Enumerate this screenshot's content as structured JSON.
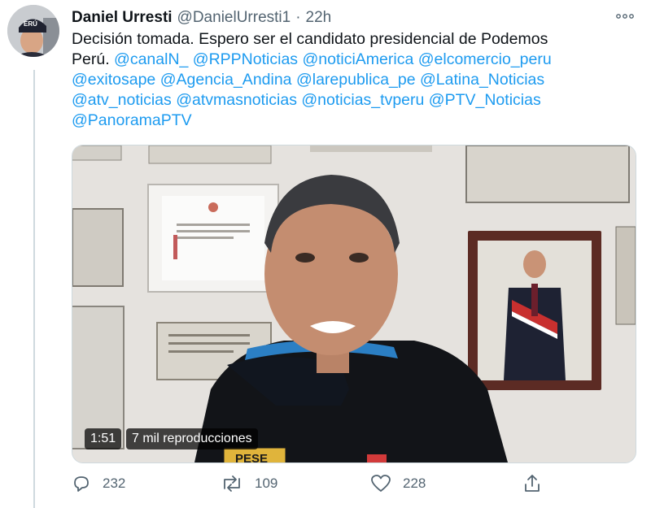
{
  "tweet": {
    "author_name": "Daniel Urresti",
    "handle": "@DanielUrresti1",
    "separator": "·",
    "time": "22h",
    "text_line1": "Decisión tomada. Espero ser el candidato presidencial de Podemos",
    "text_line2_prefix": "Perú.",
    "mentions": [
      "@canalN_",
      "@RPPNoticias",
      "@noticiAmerica",
      "@elcomercio_peru",
      "@exitosape",
      "@Agencia_Andina",
      "@larepublica_pe",
      "@Latina_Noticias",
      "@atv_noticias",
      "@atvmasnoticias",
      "@noticias_tvperu",
      "@PTV_Noticias",
      "@PanoramaPTV"
    ]
  },
  "video": {
    "duration": "1:51",
    "views": "7 mil reproducciones",
    "cap_text": "ERÚ",
    "shirt_text": "PESE"
  },
  "actions": {
    "replies": "232",
    "retweets": "109",
    "likes": "228"
  },
  "colors": {
    "link": "#1d9bf0",
    "text": "#0f1419",
    "muted": "#536471",
    "border": "#cfd9de"
  },
  "icons": [
    "more-icon",
    "reply-icon",
    "retweet-icon",
    "like-icon",
    "share-icon",
    "play-icon"
  ]
}
